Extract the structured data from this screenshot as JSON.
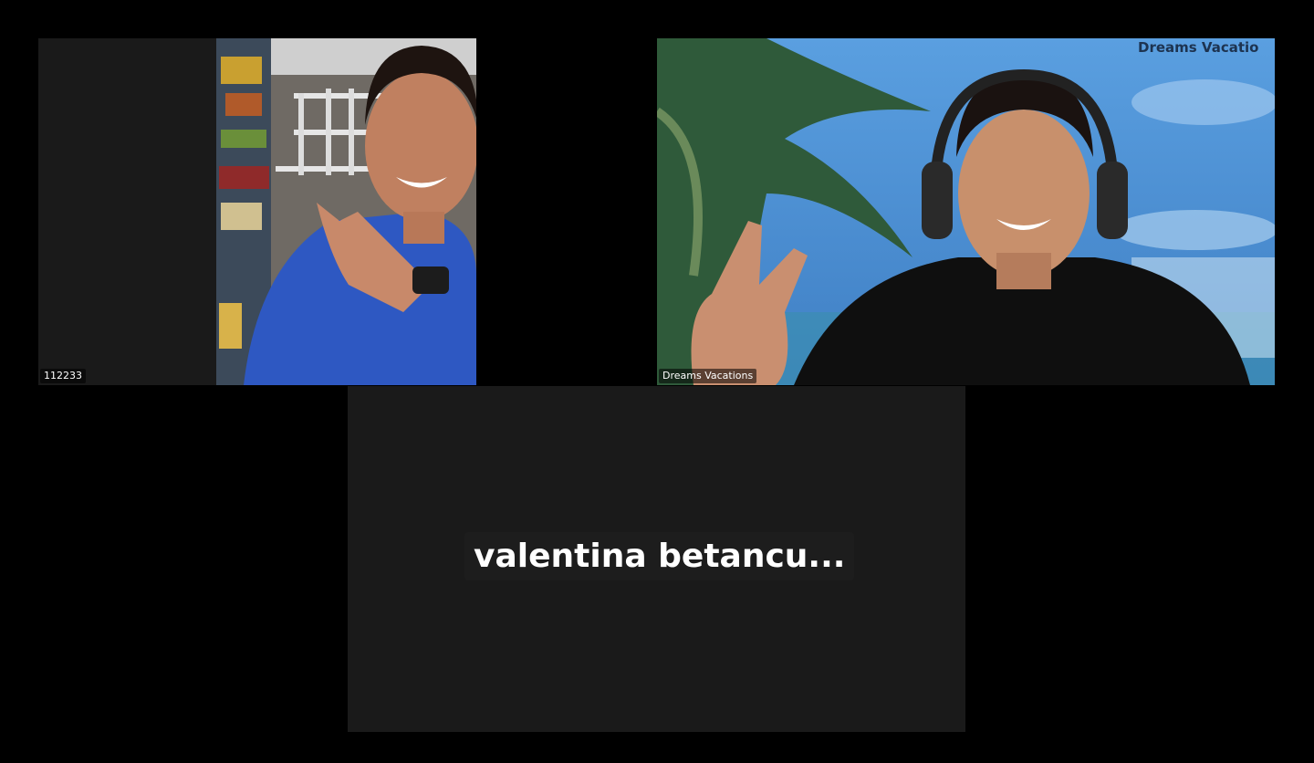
{
  "participants": [
    {
      "label": "112233",
      "video": "on"
    },
    {
      "label": "Dreams Vacations",
      "video": "on",
      "background_text": "Dreams Vacatio"
    },
    {
      "label": "valentina  betancu...",
      "video": "off"
    }
  ],
  "colors": {
    "background": "#000000",
    "tile_background": "#1a1a1a",
    "name_text": "#ffffff"
  }
}
